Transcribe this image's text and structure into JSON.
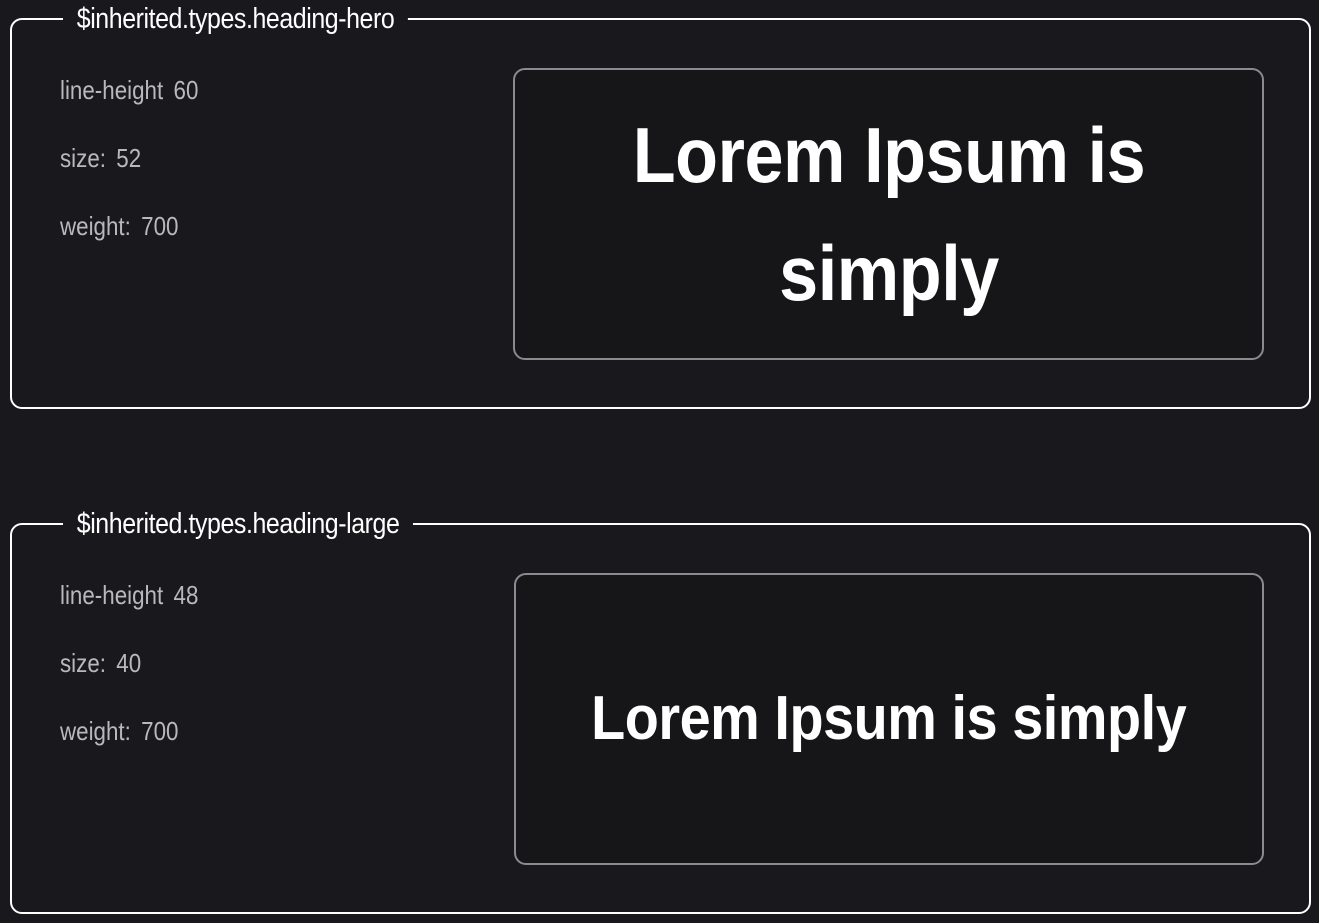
{
  "styles": [
    {
      "token": "$inherited.types.heading-hero",
      "line_height_label": "line-height",
      "line_height_value": "60",
      "size_label": "size:",
      "size_value": "52",
      "weight_label": "weight:",
      "weight_value": "700",
      "sample_text": "Lorem Ipsum is simply"
    },
    {
      "token": "$inherited.types.heading-large",
      "line_height_label": "line-height",
      "line_height_value": "48",
      "size_label": "size:",
      "size_value": "40",
      "weight_label": "weight:",
      "weight_value": "700",
      "sample_text": "Lorem Ipsum is simply"
    }
  ],
  "colors": {
    "background": "#18181d",
    "border": "#ffffff",
    "preview_background": "#161618",
    "preview_border": "#8a8a8f",
    "label_text": "#b9b9bd",
    "sample_text": "#ffffff"
  }
}
